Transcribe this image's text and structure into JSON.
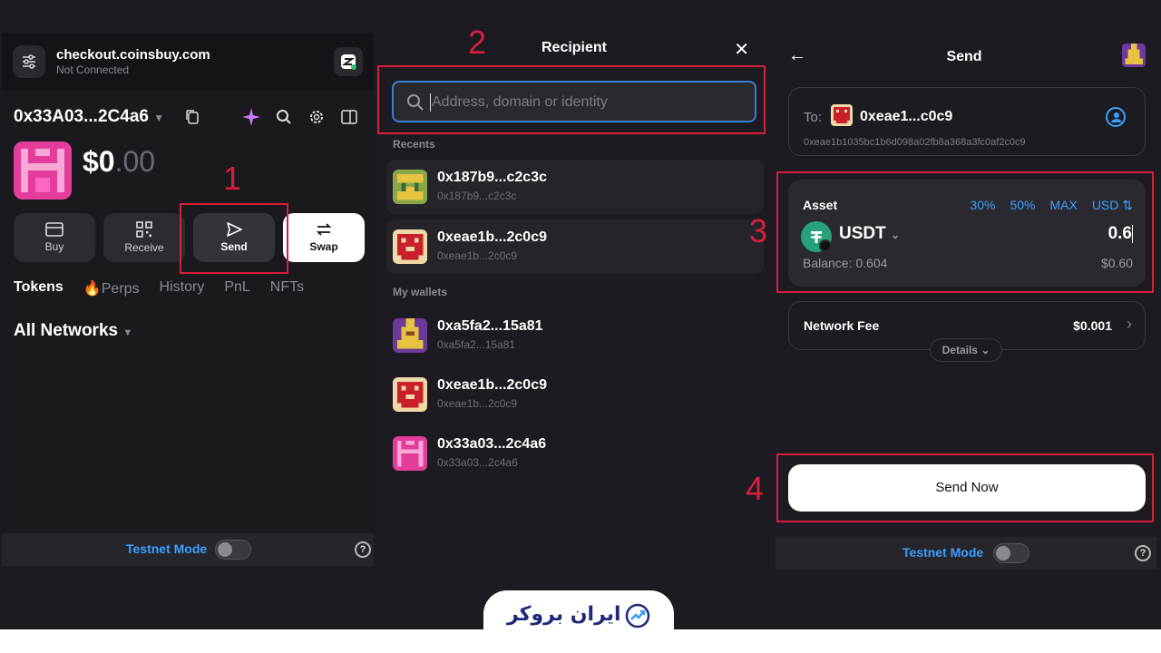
{
  "panel1": {
    "site": "checkout.coinsbuy.com",
    "status": "Not Connected",
    "address": "0x33A03...2C4a6",
    "balance_int": "$0",
    "balance_dec": ".00",
    "actions": [
      "Buy",
      "Receive",
      "Send",
      "Swap"
    ],
    "tabs": [
      "Tokens",
      "Perps",
      "History",
      "PnL",
      "NFTs"
    ],
    "networks": "All Networks",
    "testnet": "Testnet Mode"
  },
  "panel2": {
    "title": "Recipient",
    "search_placeholder": "Address, domain or identity",
    "recents_label": "Recents",
    "recents": [
      {
        "name": "0x187b9...c2c3c",
        "sub": "0x187b9...c2c3c"
      },
      {
        "name": "0xeae1b...2c0c9",
        "sub": "0xeae1b...2c0c9"
      }
    ],
    "wallets_label": "My wallets",
    "wallets": [
      {
        "name": "0xa5fa2...15a81",
        "sub": "0xa5fa2...15a81"
      },
      {
        "name": "0xeae1b...2c0c9",
        "sub": "0xeae1b...2c0c9"
      },
      {
        "name": "0x33a03...2c4a6",
        "sub": "0x33a03...2c4a6"
      }
    ]
  },
  "panel3": {
    "title": "Send",
    "to_label": "To:",
    "to_name": "0xeae1...c0c9",
    "to_full": "0xeae1b1035bc1b6d098a02fb8a368a3fc0af2c0c9",
    "asset_label": "Asset",
    "pcts": [
      "30%",
      "50%",
      "MAX",
      "USD ⇅"
    ],
    "token": "USDT",
    "amount": "0.6",
    "balance": "Balance: 0.604",
    "usd_value": "$0.60",
    "fee_label": "Network Fee",
    "fee_value": "$0.001",
    "details": "Details",
    "send_now": "Send Now",
    "testnet": "Testnet Mode"
  },
  "annotations": [
    "1",
    "2",
    "3",
    "4"
  ],
  "logo_text": "ایران بروکر",
  "colors": {
    "accent_blue": "#3aa0ff",
    "annotation_red": "#d81e3a",
    "tether_green": "#26a17b"
  }
}
